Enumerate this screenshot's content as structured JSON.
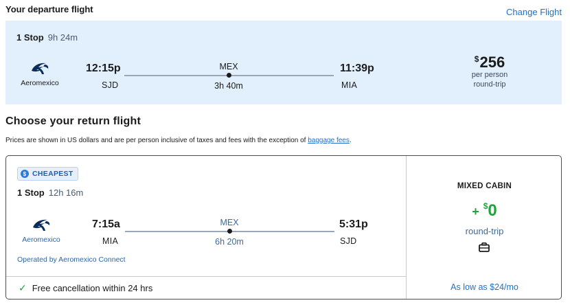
{
  "departure": {
    "heading": "Your departure flight",
    "change_label": "Change Flight",
    "stops": "1 Stop",
    "duration": "9h 24m",
    "airline": "Aeromexico",
    "depart_time": "12:15p",
    "depart_code": "SJD",
    "stop_code": "MEX",
    "leg_duration": "3h 40m",
    "arrive_time": "11:39p",
    "arrive_code": "MIA",
    "price_currency": "$",
    "price_amount": "256",
    "price_line1": "per person",
    "price_line2": "round-trip"
  },
  "return_section": {
    "heading": "Choose your return flight",
    "disclaimer_text": "Prices are shown in US dollars and are per person inclusive of taxes and fees with the exception of ",
    "disclaimer_link": "baggage fees",
    "disclaimer_end": "."
  },
  "return_option": {
    "badge": "CHEAPEST",
    "badge_icon": "dollar-badge-icon",
    "stops": "1 Stop",
    "duration": "12h 16m",
    "airline": "Aeromexico",
    "depart_time": "7:15a",
    "depart_code": "MIA",
    "stop_code": "MEX",
    "leg_duration": "6h 20m",
    "arrive_time": "5:31p",
    "arrive_code": "SJD",
    "operated_by": "Operated by Aeromexico Connect",
    "free_cancel": "Free cancellation within 24 hrs",
    "cabin": "MIXED CABIN",
    "add_sign": "+",
    "add_currency": "$",
    "add_amount": "0",
    "add_sub": "round-trip",
    "bag_icon": "carry-on-bag-icon",
    "low_price": "As low as $24/mo"
  },
  "colors": {
    "accent_blue": "#1f6fd1",
    "card_bg": "#e2effc",
    "price_green": "#20a33b"
  }
}
